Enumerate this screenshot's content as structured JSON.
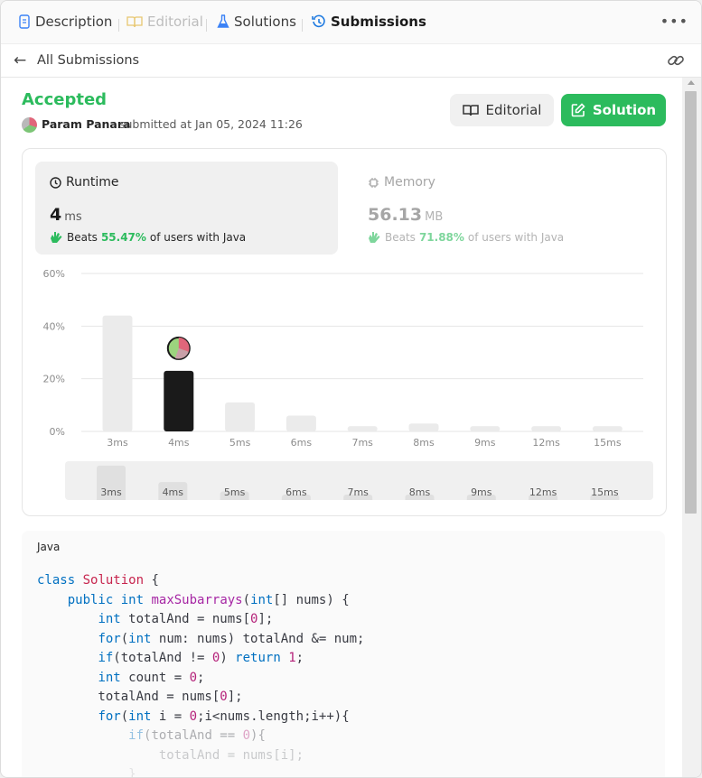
{
  "tabs": {
    "description": "Description",
    "editorial": "Editorial",
    "solutions": "Solutions",
    "submissions": "Submissions"
  },
  "nav": {
    "back_label": "All Submissions"
  },
  "submission": {
    "status": "Accepted",
    "author": "Param Panara",
    "submitted_at": "submitted at Jan 05, 2024 11:26"
  },
  "buttons": {
    "editorial": "Editorial",
    "solution": "Solution"
  },
  "runtime": {
    "label": "Runtime",
    "value": "4",
    "unit": "ms",
    "beats_prefix": "Beats",
    "beats_pct": "55.47%",
    "beats_suffix": "of users with Java"
  },
  "memory": {
    "label": "Memory",
    "value": "56.13",
    "unit": "MB",
    "beats_prefix": "Beats",
    "beats_pct": "71.88%",
    "beats_suffix": "of users with Java"
  },
  "chart_data": {
    "type": "bar",
    "categories": [
      "3ms",
      "4ms",
      "5ms",
      "6ms",
      "7ms",
      "8ms",
      "9ms",
      "12ms",
      "15ms"
    ],
    "values": [
      44,
      23,
      11,
      6,
      2,
      3,
      2,
      2,
      2
    ],
    "y_ticks": [
      "0%",
      "20%",
      "40%",
      "60%"
    ],
    "ylim": [
      0,
      60
    ],
    "highlight": "4ms",
    "grid": true,
    "colors": {
      "bar": "#ebebeb",
      "highlight": "#1a1a1a",
      "grid": "#e6e6e6"
    }
  },
  "scrubber": {
    "labels": [
      "3ms",
      "4ms",
      "5ms",
      "6ms",
      "7ms",
      "8ms",
      "9ms",
      "12ms",
      "15ms"
    ]
  },
  "code": {
    "language": "Java"
  },
  "colors": {
    "accent": "#2cbb5d",
    "submissions_icon": "#1f7ae0"
  }
}
